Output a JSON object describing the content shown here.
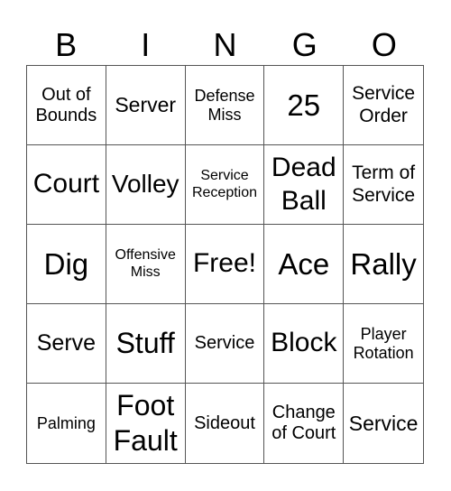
{
  "header": [
    "B",
    "I",
    "N",
    "G",
    "O"
  ],
  "cells": [
    [
      "Out of\nBounds",
      "Server",
      "Defense\nMiss",
      "25",
      "Service\nOrder"
    ],
    [
      "Court",
      "Volley",
      "Service\nReception",
      "Dead\nBall",
      "Term of\nService"
    ],
    [
      "Dig",
      "Offensive\nMiss",
      "Free!",
      "Ace",
      "Rally"
    ],
    [
      "Serve",
      "Stuff",
      "Service",
      "Block",
      "Player\nRotation"
    ],
    [
      "Palming",
      "Foot\nFault",
      "Sideout",
      "Change\nof Court",
      "Service"
    ]
  ]
}
